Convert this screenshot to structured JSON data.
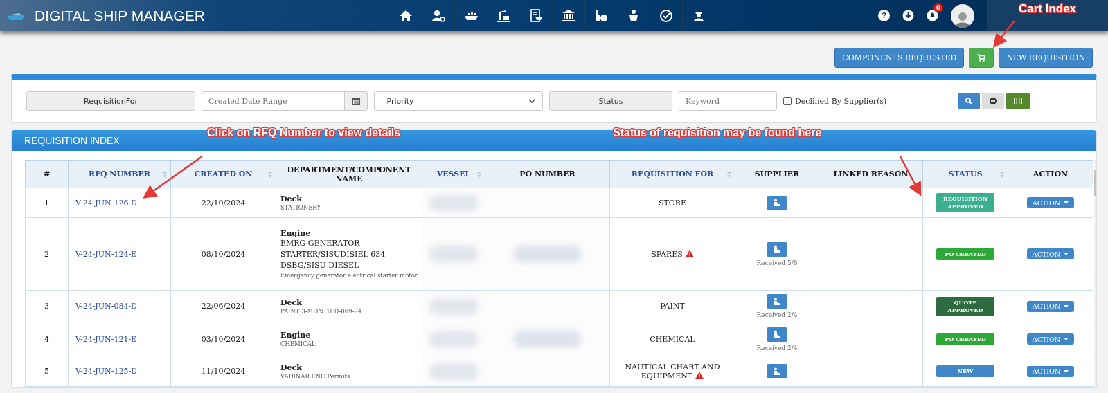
{
  "header": {
    "title": "DIGITAL SHIP MANAGER",
    "help_label": "?",
    "notification_count": "0"
  },
  "toolbar": {
    "buttons": [
      {
        "kind": "text",
        "label": "COMPONENTS REQUESTED"
      },
      {
        "kind": "cart"
      },
      {
        "kind": "text",
        "label": "NEW REQUISITION"
      }
    ]
  },
  "filters": {
    "requisition_for": "-- RequisitionFor --",
    "date_range": {
      "placeholder": "Created Date Range"
    },
    "priority": "-- Priority --",
    "status": "-- Status --",
    "keyword": {
      "placeholder": "Keyword"
    },
    "declined_checkbox": {
      "label": "Declined By Supplier(s)",
      "checked": false
    }
  },
  "panel": {
    "title": "REQUISITION INDEX"
  },
  "table": {
    "columns": [
      {
        "label": "#",
        "sortable": false
      },
      {
        "label": "RFQ NUMBER",
        "sortable": true
      },
      {
        "label": "CREATED ON",
        "sortable": true
      },
      {
        "label": "DEPARTMENT/COMPONENT NAME",
        "sortable": false
      },
      {
        "label": "VESSEL",
        "sortable": true
      },
      {
        "label": "PO NUMBER",
        "sortable": false
      },
      {
        "label": "REQUISITION FOR",
        "sortable": true
      },
      {
        "label": "SUPPLIER",
        "sortable": false
      },
      {
        "label": "LINKED REASON",
        "sortable": false
      },
      {
        "label": "STATUS",
        "sortable": true
      },
      {
        "label": "ACTION",
        "sortable": false
      }
    ],
    "rows": [
      {
        "number": "1",
        "rfq": "V-24-JUN-126-D",
        "created_on": "22/10/2024",
        "department": "Deck",
        "component": "STATIONERY",
        "po_blurred": false,
        "requisition_for": "STORE",
        "warning": false,
        "status": {
          "label": "REQUISITION APPROVED",
          "color": "#3bb08f"
        },
        "action": "ACTION"
      },
      {
        "number": "2",
        "rfq": "V-24-JUN-124-E",
        "created_on": "08/10/2024",
        "department": "Engine",
        "component_name": "EMRG GENERATOR STARTER/SISUDISIEL 634 DSBG/SISU DIESEL",
        "component": "Emergency generator electrical starter motor",
        "po_blurred": true,
        "requisition_for": "SPARES",
        "warning": true,
        "received": "Received 5/8",
        "status": {
          "label": "PO CREATED",
          "color": "#2ea836"
        },
        "action": "ACTION"
      },
      {
        "number": "3",
        "rfq": "V-24-JUN-084-D",
        "created_on": "22/06/2024",
        "department": "Deck",
        "component": "PAINT 3-MONTH D-069-24",
        "po_blurred": false,
        "requisition_for": "PAINT",
        "warning": false,
        "received": "Received 2/4",
        "status": {
          "label": "QUOTE APPROVED",
          "color": "#2e6b3e"
        },
        "action": "ACTION"
      },
      {
        "number": "4",
        "rfq": "V-24-JUN-121-E",
        "created_on": "03/10/2024",
        "department": "Engine",
        "component": "CHEMICAL",
        "po_blurred": true,
        "requisition_for": "CHEMICAL",
        "warning": false,
        "received": "Received 2/4",
        "status": {
          "label": "PO CREATED",
          "color": "#2ea836"
        },
        "action": "ACTION"
      },
      {
        "number": "5",
        "rfq": "V-24-JUN-125-D",
        "created_on": "11/10/2024",
        "department": "Deck",
        "component": "VADINAR ENC Permits",
        "po_blurred": false,
        "requisition_for": "NAUTICAL CHART AND EQUIPMENT",
        "warning": true,
        "status": {
          "label": "NEW",
          "color": "#3f87c9"
        },
        "action": "ACTION"
      }
    ]
  },
  "annotations": [
    {
      "text": "Cart Index"
    },
    {
      "text": "Click on RFQ Number to view details"
    },
    {
      "text": "Status of requisition may be found here"
    }
  ]
}
